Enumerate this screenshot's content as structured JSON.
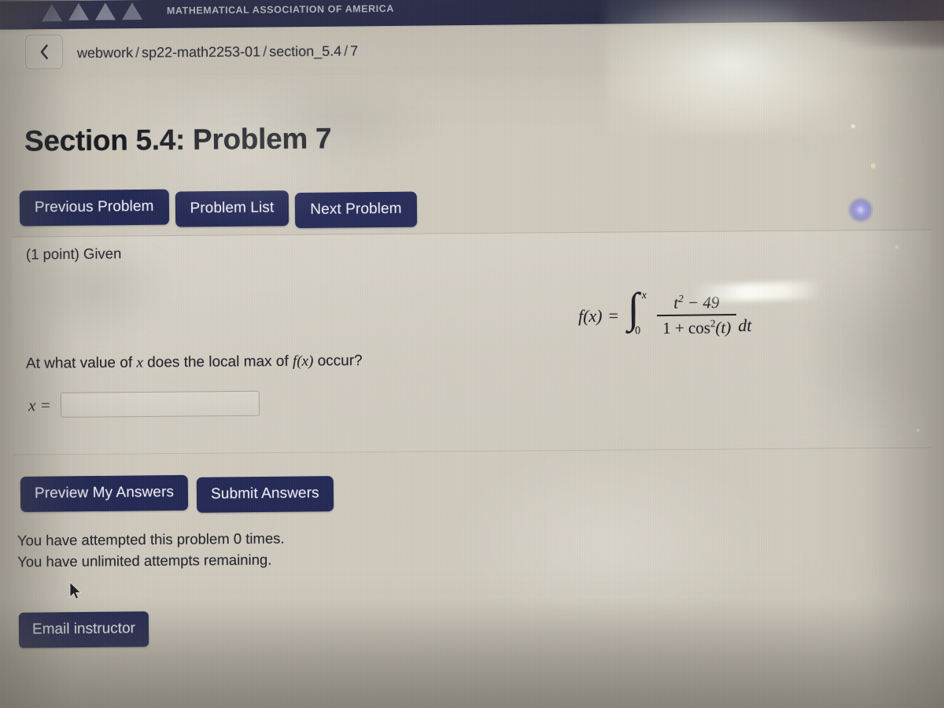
{
  "banner": {
    "org_name": "MATHEMATICAL ASSOCIATION OF AMERICA",
    "logo_icon": "maa-triangles-logo",
    "background_color": "#262a4e"
  },
  "breadcrumb": {
    "back_icon": "chevron-left-icon",
    "course_root": "webwork",
    "course": "sp22-math2253-01",
    "section": "section_5.4",
    "problem": "7",
    "separator": "/"
  },
  "problem": {
    "title": "Section 5.4: Problem 7",
    "points_line": "(1 point) Given",
    "question": "At what value of x does the local max of f(x) occur?",
    "question_parts": {
      "before_var": "At what value of ",
      "var": "x",
      "middle": " does the local max of ",
      "func": "f(x)",
      "after": " occur?"
    },
    "formula": {
      "lhs": "f(x)",
      "equals": "=",
      "integral_symbol": "∫",
      "upper_limit": "x",
      "lower_limit": "0",
      "numerator_base": "t",
      "numerator_exp": "2",
      "numerator_rest": " − 49",
      "denominator_prefix": "1 + cos",
      "denominator_exp": "2",
      "denominator_arg": "(t)",
      "differential": "dt"
    },
    "answer_label": "x =",
    "answer_value": "",
    "answer_placeholder": ""
  },
  "nav_buttons": {
    "previous": "Previous Problem",
    "list": "Problem List",
    "next": "Next Problem",
    "color": "#242a55"
  },
  "action_buttons": {
    "preview": "Preview My Answers",
    "submit": "Submit Answers",
    "email": "Email instructor"
  },
  "status": {
    "attempts_line": "You have attempted this problem 0 times.",
    "remaining_line": "You have unlimited attempts remaining.",
    "attempt_count": "0",
    "remaining_count": "unlimited"
  },
  "cursor": {
    "icon": "mouse-pointer-arrow"
  }
}
